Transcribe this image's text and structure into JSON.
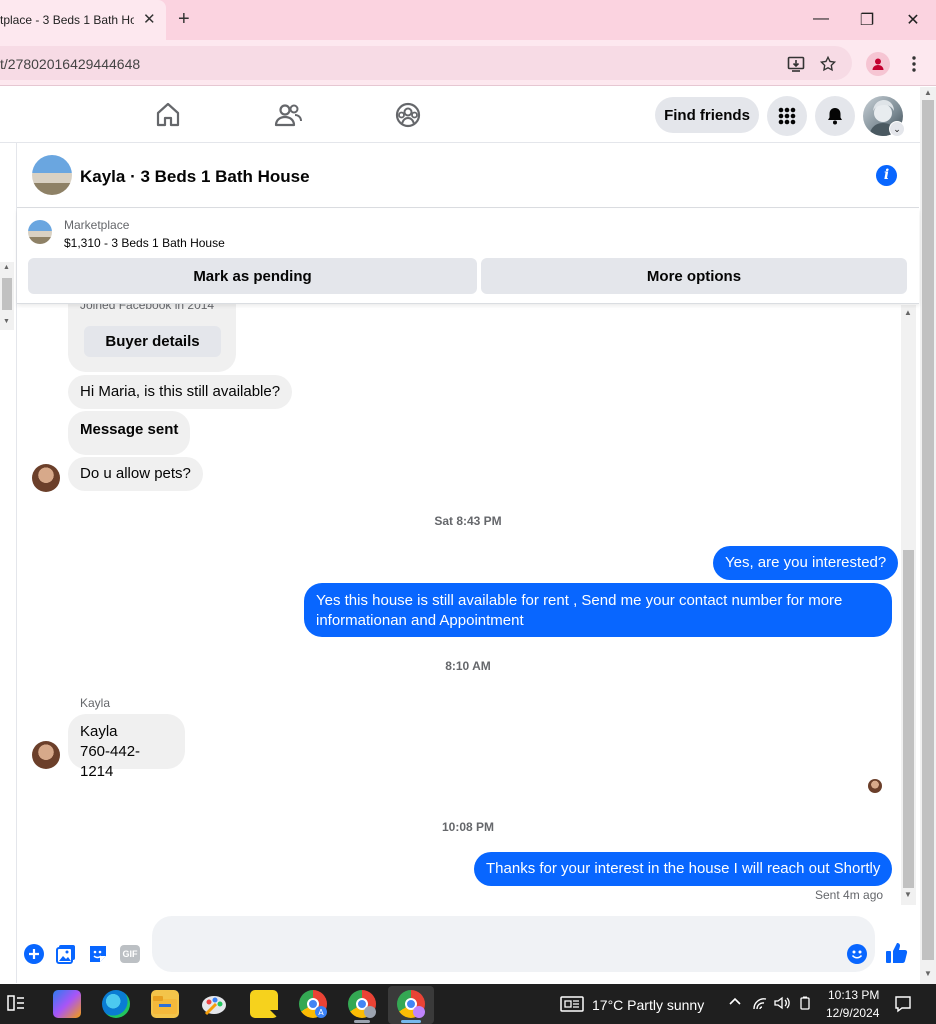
{
  "browser": {
    "tab_title": "tplace - 3 Beds 1 Bath Ho",
    "tab_close": "✕",
    "new_tab": "+",
    "url": "t/27802016429444648",
    "window_controls": {
      "minimize": "—",
      "restore": "❐",
      "close": "✕"
    }
  },
  "fb_nav": {
    "find_friends": "Find friends",
    "icons": [
      "home-icon",
      "friends-icon",
      "groups-icon",
      "apps-grid-icon",
      "notifications-bell-icon",
      "profile-avatar"
    ]
  },
  "conversation": {
    "title": "Kayla · 3 Beds 1 Bath House",
    "marketplace": {
      "label": "Marketplace",
      "listing": "$1,310 - 3 Beds 1 Bath House",
      "mark_pending": "Mark as pending",
      "more_options": "More options"
    },
    "buyer_card": {
      "joined": "Joined Facebook in 2014",
      "buyer_details": "Buyer details"
    },
    "messages": [
      {
        "from": "them",
        "text": "Hi Maria, is this still available?"
      },
      {
        "from": "them",
        "text": "Message sent"
      },
      {
        "from": "them",
        "text": "Do u allow pets?"
      },
      {
        "type": "timestamp",
        "text": "Sat 8:43 PM"
      },
      {
        "from": "me",
        "text": "Yes, are you interested?"
      },
      {
        "from": "me",
        "text": "Yes this house is still available for rent , Send me your contact number for more informationan and Appointment"
      },
      {
        "type": "timestamp",
        "text": "8:10 AM"
      },
      {
        "from": "them",
        "sender": "Kayla",
        "text_line1": "Kayla",
        "text_line2": "760-442-1214"
      },
      {
        "type": "timestamp",
        "text": "10:08 PM"
      },
      {
        "from": "me",
        "text": "Thanks for your interest in the house I will reach out Shortly"
      }
    ],
    "sent_status": "Sent 4m ago"
  },
  "composer": {
    "icons": [
      "add-icon",
      "photo-icon",
      "sticker-icon",
      "gif-icon",
      "emoji-icon",
      "like-icon"
    ],
    "gif_label": "GIF"
  },
  "taskbar": {
    "weather": "17°C  Partly sunny",
    "time": "10:13 PM",
    "date": "12/9/2024"
  },
  "colors": {
    "messenger_blue": "#0866ff",
    "bubble_gray": "#f0f0f0",
    "tab_pink": "#fbd3e0"
  }
}
